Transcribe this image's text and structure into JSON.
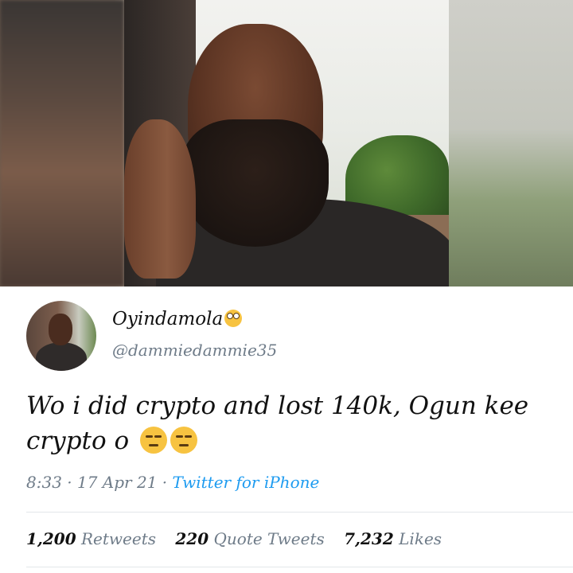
{
  "tweet": {
    "display_name": "Oyindamola",
    "handle": "@dammiedammie35",
    "text_line": "Wo i did crypto and lost 140k, Ogun kee crypto o",
    "time": "8:33",
    "date": "17 Apr 21",
    "source": "Twitter for iPhone",
    "separator": "·",
    "emojis": {
      "name_emoji": "face-with-rolling-eyes-icon",
      "text_emoji": "unamused-face-icon"
    }
  },
  "stats": {
    "retweets_count": "1,200",
    "retweets_label": "Retweets",
    "quotes_count": "220",
    "quotes_label": "Quote Tweets",
    "likes_count": "7,232",
    "likes_label": "Likes"
  },
  "colors": {
    "meta_gray": "#6e7b88",
    "link_blue": "#1d9bf0",
    "text": "#111111",
    "divider": "#e3e7ea",
    "emoji_yellow": "#f7c341"
  }
}
